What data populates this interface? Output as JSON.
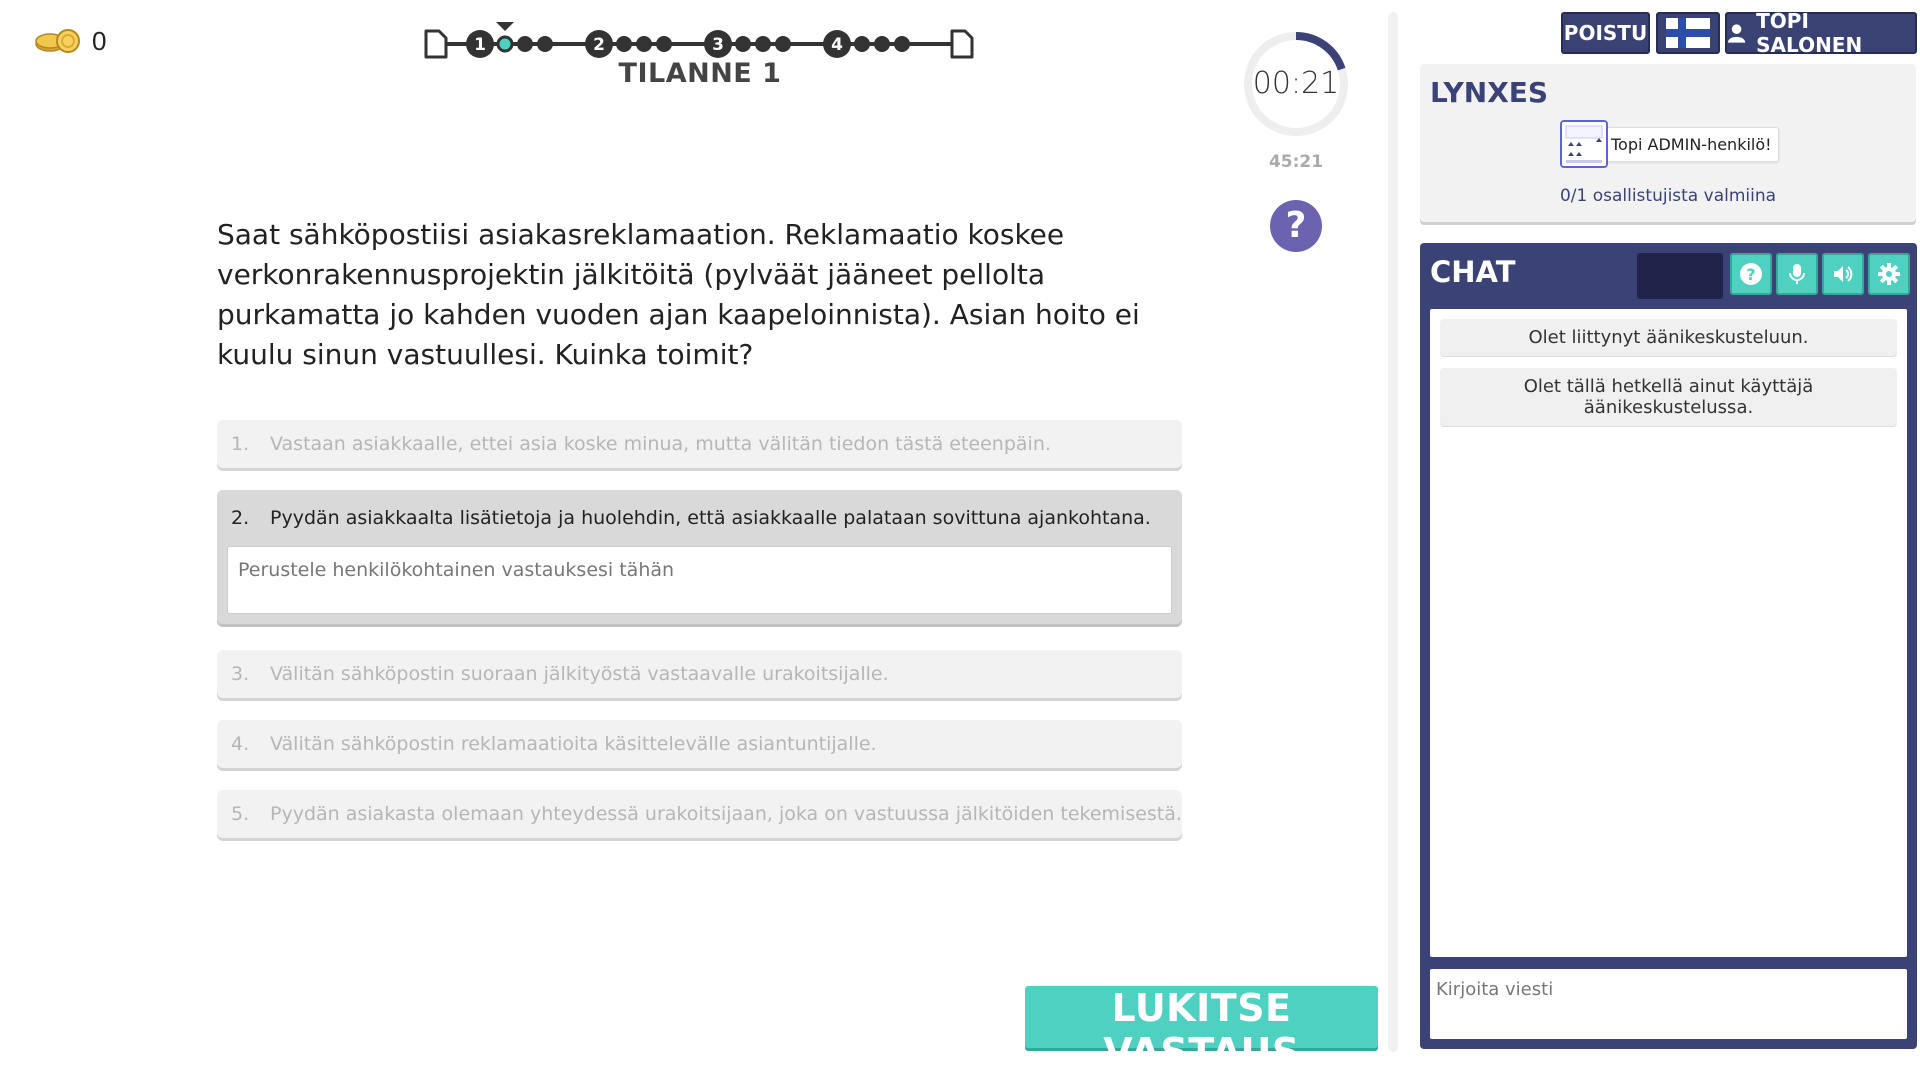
{
  "coins": {
    "count": "0",
    "icon": "coin-icon"
  },
  "progress": {
    "stage_title": "TILANNE 1",
    "stages": [
      "1",
      "2",
      "3",
      "4"
    ],
    "dots_per_stage": 3,
    "current_stage_index": 0,
    "current_dot_index": 0,
    "accent": "#4fd1c1"
  },
  "timer": {
    "remaining": "00:21",
    "total": "45:21",
    "fraction_elapsed": 0.2
  },
  "help": {
    "label": "?"
  },
  "question": {
    "text": "Saat sähköpostiisi asiakasreklamaation. Reklamaatio koskee verkonrakennusprojektin jälkitöitä (pylväät jääneet pellolta purkamatta jo kahden vuoden ajan kaapeloinnista). Asian hoito ei kuulu sinun vastuullesi. Kuinka toimit?"
  },
  "options": [
    {
      "num": "1.",
      "text": "Vastaan asiakkaalle, ettei asia koske minua, mutta välitän tiedon tästä eteenpäin."
    },
    {
      "num": "2.",
      "text": "Pyydän asiakkaalta lisätietoja ja huolehdin, että asiakkaalle palataan sovittuna ajankohtana.",
      "placeholder": "Perustele henkilökohtainen vastauksesi tähän"
    },
    {
      "num": "3.",
      "text": "Välitän sähköpostin suoraan jälkityöstä vastaavalle urakoitsijalle."
    },
    {
      "num": "4.",
      "text": "Välitän sähköpostin reklamaatioita käsittelevälle asiantuntijalle."
    },
    {
      "num": "5.",
      "text": "Pyydän asiakasta olemaan yhteydessä urakoitsijaan, joka on vastuussa jälkitöiden tekemisestä."
    }
  ],
  "lock_button": "LUKITSE VASTAUS",
  "header_buttons": {
    "exit": "POISTU",
    "user": "TOPI SALONEN",
    "language_icon": "finland-flag-icon"
  },
  "team": {
    "name": "LYNXES",
    "member": "Topi ADMIN-henkilö!",
    "ready_status": "0/1 osallistujista valmiina"
  },
  "chat": {
    "title": "CHAT",
    "messages": [
      "Olet liittynyt äänikeskusteluun.",
      "Olet tällä hetkellä ainut käyttäjä äänikeskustelussa."
    ],
    "input_placeholder": "Kirjoita viesti",
    "tool_icons": [
      "help-icon",
      "microphone-icon",
      "speaker-icon",
      "settings-icon"
    ]
  },
  "colors": {
    "navy": "#3b4376",
    "teal": "#4fd1c1",
    "purple": "#6b62b0"
  }
}
